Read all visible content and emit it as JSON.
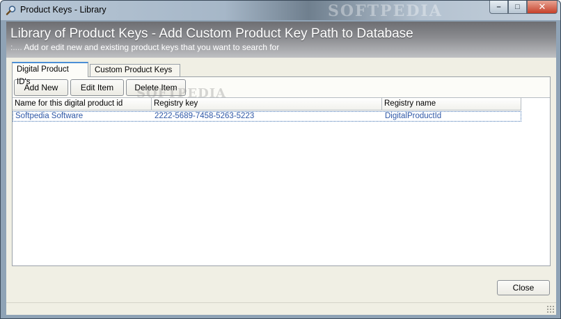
{
  "window": {
    "title": "Product Keys - Library",
    "watermark": "SOFTPEDIA",
    "controls": {
      "minimize": "–",
      "maximize": "□",
      "close": "✕"
    }
  },
  "header": {
    "title": "Library of Product Keys - Add Custom Product Key Path to Database",
    "subtitle_prefix": ":....",
    "subtitle": "Add or edit new and existing product keys that you want to search for"
  },
  "tabs": [
    {
      "label": "Digital Product ID's",
      "active": true
    },
    {
      "label": "Custom Product Keys",
      "active": false
    }
  ],
  "toolbar": {
    "add_label": "Add New",
    "edit_label": "Edit Item",
    "delete_label": "Delete Item"
  },
  "list": {
    "columns": [
      "Name for this digital product id",
      "Registry key",
      "Registry name"
    ],
    "rows": [
      {
        "name": "Softpedia Software",
        "registry_key": "2222-5689-7458-5263-5223",
        "registry_name": "DigitalProductId"
      }
    ]
  },
  "footer": {
    "close_label": "Close"
  }
}
